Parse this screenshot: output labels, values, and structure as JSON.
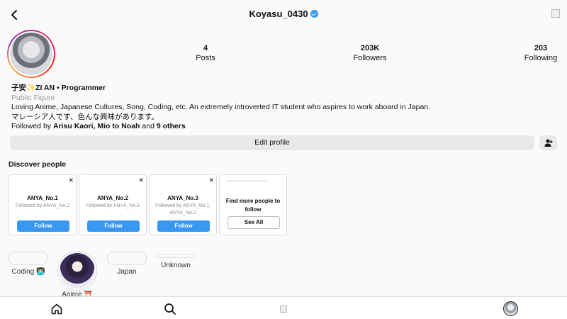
{
  "header": {
    "username": "Koyasu_0430",
    "back_icon": "back-arrow-icon",
    "verified_icon": "verified-badge-icon",
    "menu_icon": "broken-image-icon"
  },
  "profile": {
    "stats": {
      "posts_count": "4",
      "posts_label": "Posts",
      "followers_count": "203K",
      "followers_label": "Followers",
      "following_count": "203",
      "following_label": "Following"
    },
    "display_name": "子安",
    "display_sparkle": "✨",
    "display_name_rest": "ZI AN • Programmer",
    "category": "Public Figure",
    "bio_line1": "Loving Anime, Japanese Cultures, Song, Coding, etc. An extremely introverted IT student who aspires to work aboard in Japan.",
    "bio_line2": "マレーシア人です、色んな興味があります。",
    "followed_by_prefix": "Followed by ",
    "followed_by_names": "Arisu Kaori, Mio to Noah",
    "followed_by_and": " and ",
    "followed_by_others": "9 others",
    "edit_profile_label": "Edit profile"
  },
  "discover": {
    "title": "Discover people",
    "cards": [
      {
        "username": "ANYA_No.1",
        "sub": "Followed by ANYA_No.2",
        "button": "Follow"
      },
      {
        "username": "ANYA_No.2",
        "sub": "Followed by ANYA_No.1",
        "button": "Follow"
      },
      {
        "username": "ANYA_No.3",
        "sub": "Followed by ANYA_No.1, ANYA_No.2",
        "button": "Follow"
      }
    ],
    "close_glyph": "✕",
    "find_more_text": "Find more people to follow",
    "see_all_label": "See All"
  },
  "highlights": [
    {
      "label": "Coding 👨🏻‍💻"
    },
    {
      "label": "Anime ⛩️"
    },
    {
      "label": "Japan"
    },
    {
      "label": "Unknown"
    }
  ],
  "bottom_nav": {
    "items": [
      "home-icon",
      "search-icon",
      "reels-icon",
      "profile-avatar-icon"
    ]
  },
  "colors": {
    "accent": "#3897f0",
    "button_bg": "#e9e9e9",
    "muted_text": "#999999"
  }
}
